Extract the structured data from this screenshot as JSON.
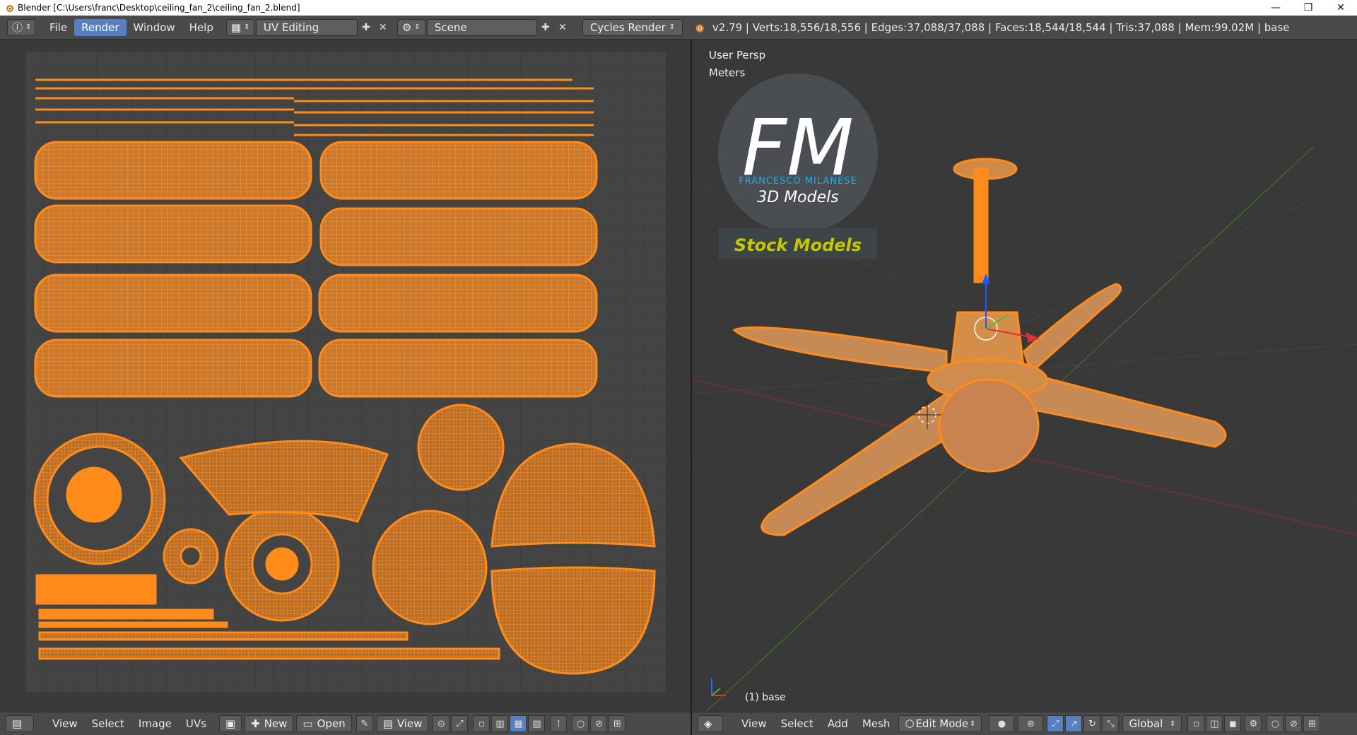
{
  "window": {
    "title": "Blender [C:\\Users\\franc\\Desktop\\ceiling_fan_2\\ceiling_fan_2.blend]",
    "minimize": "—",
    "restore": "❐",
    "close": "✕"
  },
  "topbar": {
    "menus": [
      "File",
      "Render",
      "Window",
      "Help"
    ],
    "active_menu": "Render",
    "screen_layout": "UV Editing",
    "scene": "Scene",
    "render_engine": "Cycles Render",
    "stats": "v2.79 | Verts:18,556/18,556 | Edges:37,088/37,088 | Faces:18,544/18,544 | Tris:37,088 | Mem:99.02M | base"
  },
  "uv_editor": {
    "menus": [
      "View",
      "Select",
      "Image",
      "UVs"
    ],
    "new_label": "New",
    "open_label": "Open",
    "view_label": "View"
  },
  "viewport": {
    "view_name": "User Persp",
    "units": "Meters",
    "object_label": "(1) base",
    "logo_letters": "FM",
    "logo_name": "FRANCESCO MILANESE",
    "logo_sub": "3D Models",
    "stock_label": "Stock Models",
    "menus": [
      "View",
      "Select",
      "Add",
      "Mesh"
    ],
    "mode": "Edit Mode",
    "orientation": "Global"
  },
  "colors": {
    "accent": "#5680c2",
    "mesh": "#ff8c1a",
    "logo_blue": "#29a9e0",
    "stock_yellow": "#c8c800"
  }
}
